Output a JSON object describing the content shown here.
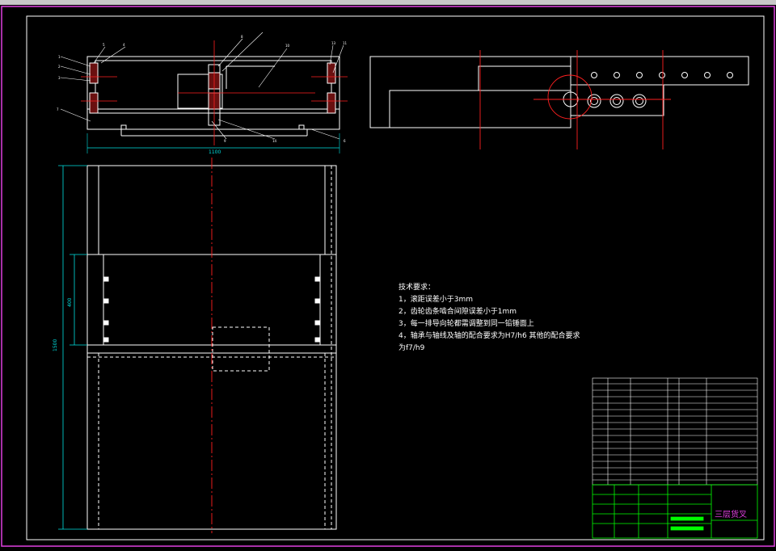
{
  "toolbar": {
    "label": ""
  },
  "drawing": {
    "dim_width": "1100",
    "dim_height": "1500",
    "dim_window": "400",
    "tech_title": "技术要求：",
    "tech_lines": [
      "1，滚距误差小于3mm",
      "2，齿轮齿条啮合间隙误差小于1mm",
      "3，每一排导向轮都需调整到同一铅锤面上",
      "4，轴承与轴线及轴的配合要求为H7/h6 其他的配合要求",
      "为f7/h9"
    ],
    "title_block": {
      "name": "三层货叉"
    },
    "colors": {
      "outline": "#ffffff",
      "center": "#ff2020",
      "dimension": "#00e0e0",
      "frame": "#e040e0",
      "title": "#00ff00"
    }
  }
}
